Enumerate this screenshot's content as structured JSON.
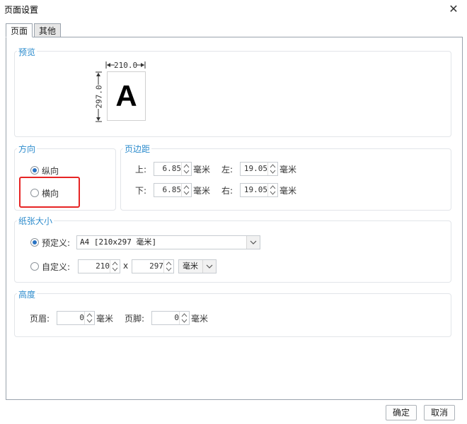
{
  "window": {
    "title": "页面设置",
    "close_label": "✕"
  },
  "tabs": [
    {
      "label": "页面",
      "active": true
    },
    {
      "label": "其他",
      "active": false
    }
  ],
  "preview": {
    "group_label": "预览",
    "width_label": "210.0",
    "height_label": "297.0",
    "page_letter": "A"
  },
  "orientation": {
    "group_label": "方向",
    "portrait_label": "纵向",
    "landscape_label": "横向",
    "selected": "portrait"
  },
  "margins": {
    "group_label": "页边距",
    "top_label": "上:",
    "top_value": "6.85",
    "left_label": "左:",
    "left_value": "19.05",
    "bottom_label": "下:",
    "bottom_value": "6.85",
    "right_label": "右:",
    "right_value": "19.05",
    "unit": "毫米"
  },
  "paper": {
    "group_label": "纸张大小",
    "predefined_label": "预定义:",
    "predefined_value": "A4 [210x297 毫米]",
    "custom_label": "自定义:",
    "custom_width": "210",
    "times": "x",
    "custom_height": "297",
    "unit_value": "毫米",
    "selected": "predefined"
  },
  "height": {
    "group_label": "高度",
    "header_label": "页眉:",
    "header_value": "0",
    "footer_label": "页脚:",
    "footer_value": "0",
    "unit": "毫米"
  },
  "buttons": {
    "ok_label": "确定",
    "cancel_label": "取消"
  },
  "colors": {
    "accent": "#2d8ccd",
    "highlight": "#e62424",
    "radio": "#2a73c3"
  }
}
